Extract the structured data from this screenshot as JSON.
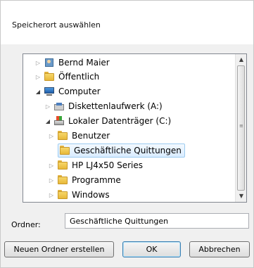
{
  "dialog": {
    "title": "Speicherort auswählen"
  },
  "tree": {
    "items": [
      {
        "label": "Bernd Maier",
        "icon": "user-icon",
        "expander": "collapsed"
      },
      {
        "label": "Öffentlich",
        "icon": "folder-icon",
        "expander": "collapsed"
      },
      {
        "label": "Computer",
        "icon": "computer-icon",
        "expander": "expanded"
      },
      {
        "label": "Diskettenlaufwerk (A:)",
        "icon": "floppy-drive-icon",
        "expander": "collapsed"
      },
      {
        "label": "Lokaler Datenträger (C:)",
        "icon": "hard-drive-icon",
        "expander": "expanded"
      },
      {
        "label": "Benutzer",
        "icon": "folder-icon",
        "expander": "collapsed"
      },
      {
        "label": "Geschäftliche Quittungen",
        "icon": "folder-icon",
        "expander": "none",
        "selected": true
      },
      {
        "label": "HP LJ4x50 Series",
        "icon": "folder-icon",
        "expander": "collapsed"
      },
      {
        "label": "Programme",
        "icon": "folder-icon",
        "expander": "collapsed"
      },
      {
        "label": "Windows",
        "icon": "folder-icon",
        "expander": "collapsed"
      }
    ]
  },
  "folder": {
    "label": "Ordner:",
    "value": "Geschäftliche Quittungen"
  },
  "buttons": {
    "new_folder": "Neuen Ordner erstellen",
    "ok": "OK",
    "cancel": "Abbrechen"
  },
  "colors": {
    "selection": "#d9ecff",
    "folder": "#e7b83a",
    "default_button_border": "#3c7fb1"
  }
}
